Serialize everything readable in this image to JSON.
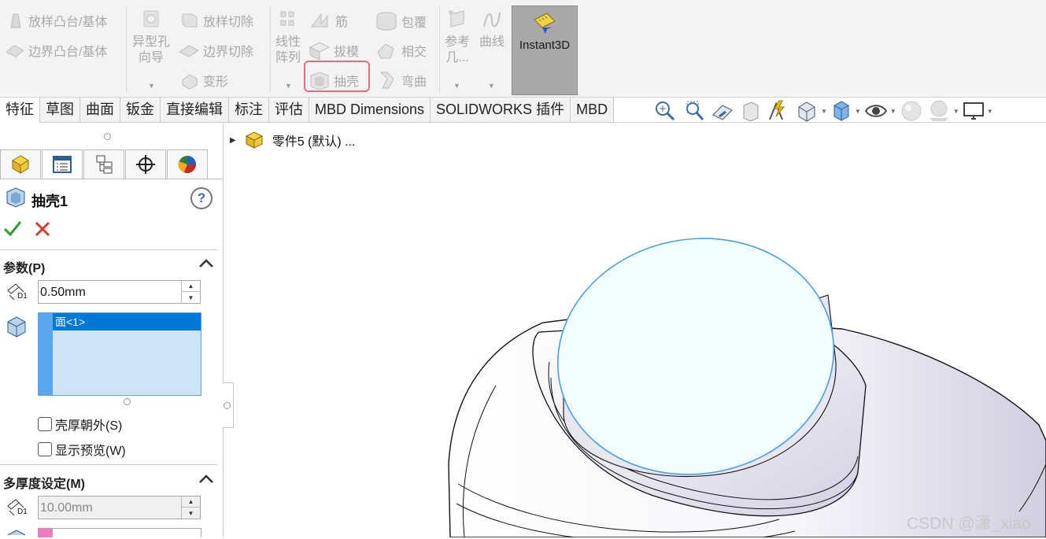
{
  "ribbon": {
    "loft_boss": "放样凸台/基体",
    "boundary_boss": "边界凸台/基体",
    "hole_wizard": [
      "异型孔",
      "向导"
    ],
    "loft_cut": "放样切除",
    "boundary_cut": "边界切除",
    "deform": "变形",
    "linear_pattern": [
      "线性",
      "阵列"
    ],
    "rib": "筋",
    "draft": "拔模",
    "shell": "抽壳",
    "wrap": "包覆",
    "intersect": "相交",
    "flex": "弯曲",
    "reference_geometry": [
      "参考",
      "几..."
    ],
    "curves": "曲线",
    "instant3d": "Instant3D"
  },
  "tabs": [
    "特征",
    "草图",
    "曲面",
    "钣金",
    "直接编辑",
    "标注",
    "评估",
    "MBD Dimensions",
    "SOLIDWORKS 插件",
    "MBD"
  ],
  "tree": {
    "part_label": "零件5 (默认) ..."
  },
  "panel": {
    "title": "抽壳1",
    "help": "?",
    "params_title": "参数(P)",
    "thickness_value": "0.50mm",
    "face_list_item": "面<1>",
    "thickness_outward": "壳厚朝外(S)",
    "show_preview": "显示预览(W)",
    "multi_title": "多厚度设定(M)",
    "multi_value": "10.00mm",
    "d1": "D1"
  },
  "colors": {
    "selection_blue": "#0078d7",
    "accent_pink": "#e36d7d",
    "face_fill": "#f1feff"
  },
  "watermark": "CSDN @潇_xiao"
}
